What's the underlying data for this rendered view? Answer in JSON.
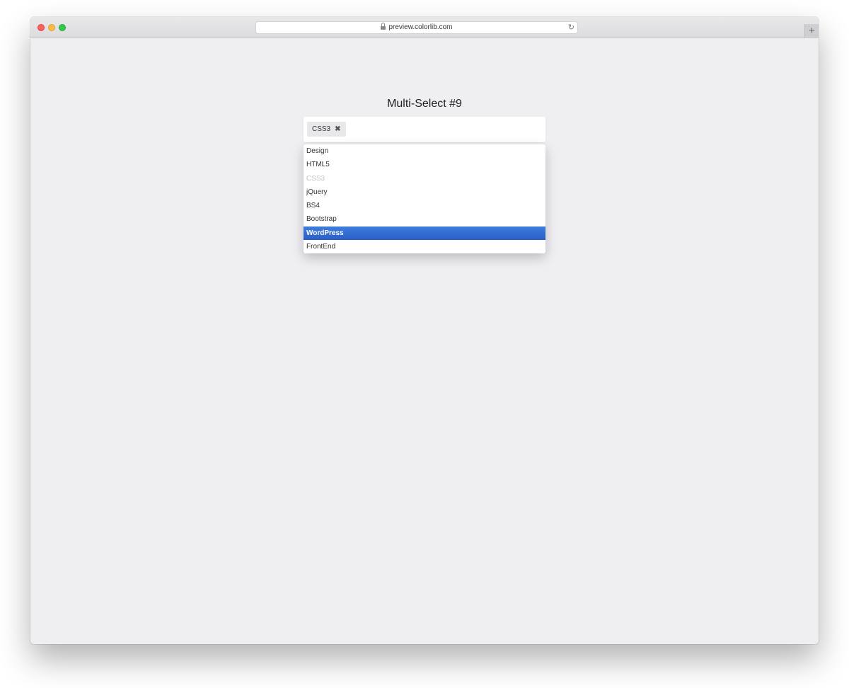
{
  "browser": {
    "url": "preview.colorlib.com",
    "reload_icon": "reload-icon",
    "newtab_label": "+"
  },
  "page": {
    "title": "Multi-Select #9"
  },
  "multiselect": {
    "selected_tags": [
      {
        "label": "CSS3",
        "close_symbol": "✖"
      }
    ],
    "options": [
      {
        "label": "Design",
        "state": "normal"
      },
      {
        "label": "HTML5",
        "state": "normal"
      },
      {
        "label": "CSS3",
        "state": "disabled"
      },
      {
        "label": "jQuery",
        "state": "normal"
      },
      {
        "label": "BS4",
        "state": "normal"
      },
      {
        "label": "Bootstrap",
        "state": "normal"
      },
      {
        "label": "WordPress",
        "state": "highlighted"
      },
      {
        "label": "FrontEnd",
        "state": "normal"
      }
    ],
    "highlight_color": "#3068d4"
  }
}
